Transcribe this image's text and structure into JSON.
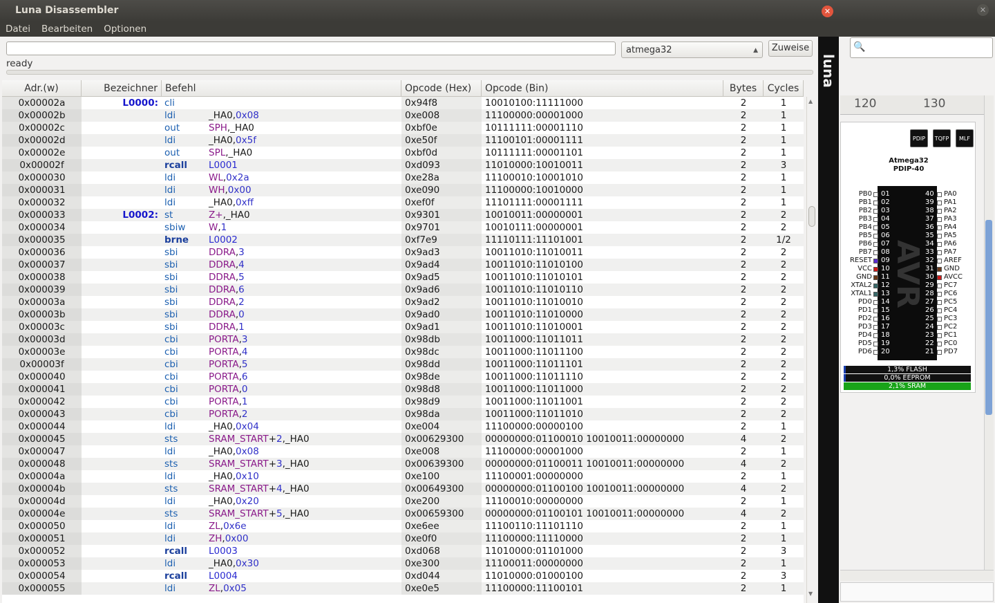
{
  "window": {
    "title": "Luna Disassembler"
  },
  "menu": [
    "Datei",
    "Bearbeiten",
    "Optionen"
  ],
  "toolbar": {
    "path_value": "",
    "chip_selected": "atmega32",
    "assign_label": "Zuweise"
  },
  "status_text": "ready",
  "columns": [
    "Adr.(w)",
    "Bezeichner",
    "Befehl",
    "Opcode (Hex)",
    "Opcode (Bin)",
    "Bytes",
    "Cycles"
  ],
  "rows": [
    {
      "adr": "0x00002a",
      "lbl": "L0000:",
      "mn": "cli",
      "op": [],
      "hex": "0x94f8",
      "bin": "10010100:11111000",
      "bytes": "2",
      "cycles": "1"
    },
    {
      "adr": "0x00002b",
      "lbl": "",
      "mn": "ldi",
      "op": [
        [
          "_HA0",
          "p"
        ],
        [
          ",",
          "p"
        ],
        [
          "0x08",
          "n"
        ]
      ],
      "hex": "0xe008",
      "bin": "11100000:00001000",
      "bytes": "2",
      "cycles": "1"
    },
    {
      "adr": "0x00002c",
      "lbl": "",
      "mn": "out",
      "op": [
        [
          "SPH",
          "r"
        ],
        [
          ",",
          "p"
        ],
        [
          "_HA0",
          "p"
        ]
      ],
      "hex": "0xbf0e",
      "bin": "10111111:00001110",
      "bytes": "2",
      "cycles": "1"
    },
    {
      "adr": "0x00002d",
      "lbl": "",
      "mn": "ldi",
      "op": [
        [
          "_HA0",
          "p"
        ],
        [
          ",",
          "p"
        ],
        [
          "0x5f",
          "n"
        ]
      ],
      "hex": "0xe50f",
      "bin": "11100101:00001111",
      "bytes": "2",
      "cycles": "1"
    },
    {
      "adr": "0x00002e",
      "lbl": "",
      "mn": "out",
      "op": [
        [
          "SPL",
          "r"
        ],
        [
          ",",
          "p"
        ],
        [
          "_HA0",
          "p"
        ]
      ],
      "hex": "0xbf0d",
      "bin": "10111111:00001101",
      "bytes": "2",
      "cycles": "1"
    },
    {
      "adr": "0x00002f",
      "lbl": "",
      "mn": "rcall",
      "bold": true,
      "op": [
        [
          "L0001",
          "l"
        ]
      ],
      "hex": "0xd093",
      "bin": "11010000:10010011",
      "bytes": "2",
      "cycles": "3"
    },
    {
      "adr": "0x000030",
      "lbl": "",
      "mn": "ldi",
      "op": [
        [
          "WL",
          "r"
        ],
        [
          ",",
          "p"
        ],
        [
          "0x2a",
          "n"
        ]
      ],
      "hex": "0xe28a",
      "bin": "11100010:10001010",
      "bytes": "2",
      "cycles": "1"
    },
    {
      "adr": "0x000031",
      "lbl": "",
      "mn": "ldi",
      "op": [
        [
          "WH",
          "r"
        ],
        [
          ",",
          "p"
        ],
        [
          "0x00",
          "n"
        ]
      ],
      "hex": "0xe090",
      "bin": "11100000:10010000",
      "bytes": "2",
      "cycles": "1"
    },
    {
      "adr": "0x000032",
      "lbl": "",
      "mn": "ldi",
      "op": [
        [
          "_HA0",
          "p"
        ],
        [
          ",",
          "p"
        ],
        [
          "0xff",
          "n"
        ]
      ],
      "hex": "0xef0f",
      "bin": "11101111:00001111",
      "bytes": "2",
      "cycles": "1"
    },
    {
      "adr": "0x000033",
      "lbl": "L0002:",
      "mn": "st",
      "op": [
        [
          "Z+",
          "r"
        ],
        [
          ",",
          "p"
        ],
        [
          "_HA0",
          "p"
        ]
      ],
      "hex": "0x9301",
      "bin": "10010011:00000001",
      "bytes": "2",
      "cycles": "2"
    },
    {
      "adr": "0x000034",
      "lbl": "",
      "mn": "sbiw",
      "op": [
        [
          "W",
          "r"
        ],
        [
          ",",
          "p"
        ],
        [
          "1",
          "n"
        ]
      ],
      "hex": "0x9701",
      "bin": "10010111:00000001",
      "bytes": "2",
      "cycles": "2"
    },
    {
      "adr": "0x000035",
      "lbl": "",
      "mn": "brne",
      "bold": true,
      "op": [
        [
          "L0002",
          "l"
        ]
      ],
      "hex": "0xf7e9",
      "bin": "11110111:11101001",
      "bytes": "2",
      "cycles": "1/2"
    },
    {
      "adr": "0x000036",
      "lbl": "",
      "mn": "sbi",
      "op": [
        [
          "DDRA",
          "r"
        ],
        [
          ",",
          "p"
        ],
        [
          "3",
          "n"
        ]
      ],
      "hex": "0x9ad3",
      "bin": "10011010:11010011",
      "bytes": "2",
      "cycles": "2"
    },
    {
      "adr": "0x000037",
      "lbl": "",
      "mn": "sbi",
      "op": [
        [
          "DDRA",
          "r"
        ],
        [
          ",",
          "p"
        ],
        [
          "4",
          "n"
        ]
      ],
      "hex": "0x9ad4",
      "bin": "10011010:11010100",
      "bytes": "2",
      "cycles": "2"
    },
    {
      "adr": "0x000038",
      "lbl": "",
      "mn": "sbi",
      "op": [
        [
          "DDRA",
          "r"
        ],
        [
          ",",
          "p"
        ],
        [
          "5",
          "n"
        ]
      ],
      "hex": "0x9ad5",
      "bin": "10011010:11010101",
      "bytes": "2",
      "cycles": "2"
    },
    {
      "adr": "0x000039",
      "lbl": "",
      "mn": "sbi",
      "op": [
        [
          "DDRA",
          "r"
        ],
        [
          ",",
          "p"
        ],
        [
          "6",
          "n"
        ]
      ],
      "hex": "0x9ad6",
      "bin": "10011010:11010110",
      "bytes": "2",
      "cycles": "2"
    },
    {
      "adr": "0x00003a",
      "lbl": "",
      "mn": "sbi",
      "op": [
        [
          "DDRA",
          "r"
        ],
        [
          ",",
          "p"
        ],
        [
          "2",
          "n"
        ]
      ],
      "hex": "0x9ad2",
      "bin": "10011010:11010010",
      "bytes": "2",
      "cycles": "2"
    },
    {
      "adr": "0x00003b",
      "lbl": "",
      "mn": "sbi",
      "op": [
        [
          "DDRA",
          "r"
        ],
        [
          ",",
          "p"
        ],
        [
          "0",
          "n"
        ]
      ],
      "hex": "0x9ad0",
      "bin": "10011010:11010000",
      "bytes": "2",
      "cycles": "2"
    },
    {
      "adr": "0x00003c",
      "lbl": "",
      "mn": "sbi",
      "op": [
        [
          "DDRA",
          "r"
        ],
        [
          ",",
          "p"
        ],
        [
          "1",
          "n"
        ]
      ],
      "hex": "0x9ad1",
      "bin": "10011010:11010001",
      "bytes": "2",
      "cycles": "2"
    },
    {
      "adr": "0x00003d",
      "lbl": "",
      "mn": "cbi",
      "op": [
        [
          "PORTA",
          "r"
        ],
        [
          ",",
          "p"
        ],
        [
          "3",
          "n"
        ]
      ],
      "hex": "0x98db",
      "bin": "10011000:11011011",
      "bytes": "2",
      "cycles": "2"
    },
    {
      "adr": "0x00003e",
      "lbl": "",
      "mn": "cbi",
      "op": [
        [
          "PORTA",
          "r"
        ],
        [
          ",",
          "p"
        ],
        [
          "4",
          "n"
        ]
      ],
      "hex": "0x98dc",
      "bin": "10011000:11011100",
      "bytes": "2",
      "cycles": "2"
    },
    {
      "adr": "0x00003f",
      "lbl": "",
      "mn": "cbi",
      "op": [
        [
          "PORTA",
          "r"
        ],
        [
          ",",
          "p"
        ],
        [
          "5",
          "n"
        ]
      ],
      "hex": "0x98dd",
      "bin": "10011000:11011101",
      "bytes": "2",
      "cycles": "2"
    },
    {
      "adr": "0x000040",
      "lbl": "",
      "mn": "cbi",
      "op": [
        [
          "PORTA",
          "r"
        ],
        [
          ",",
          "p"
        ],
        [
          "6",
          "n"
        ]
      ],
      "hex": "0x98de",
      "bin": "10011000:11011110",
      "bytes": "2",
      "cycles": "2"
    },
    {
      "adr": "0x000041",
      "lbl": "",
      "mn": "cbi",
      "op": [
        [
          "PORTA",
          "r"
        ],
        [
          ",",
          "p"
        ],
        [
          "0",
          "n"
        ]
      ],
      "hex": "0x98d8",
      "bin": "10011000:11011000",
      "bytes": "2",
      "cycles": "2"
    },
    {
      "adr": "0x000042",
      "lbl": "",
      "mn": "cbi",
      "op": [
        [
          "PORTA",
          "r"
        ],
        [
          ",",
          "p"
        ],
        [
          "1",
          "n"
        ]
      ],
      "hex": "0x98d9",
      "bin": "10011000:11011001",
      "bytes": "2",
      "cycles": "2"
    },
    {
      "adr": "0x000043",
      "lbl": "",
      "mn": "cbi",
      "op": [
        [
          "PORTA",
          "r"
        ],
        [
          ",",
          "p"
        ],
        [
          "2",
          "n"
        ]
      ],
      "hex": "0x98da",
      "bin": "10011000:11011010",
      "bytes": "2",
      "cycles": "2"
    },
    {
      "adr": "0x000044",
      "lbl": "",
      "mn": "ldi",
      "op": [
        [
          "_HA0",
          "p"
        ],
        [
          ",",
          "p"
        ],
        [
          "0x04",
          "n"
        ]
      ],
      "hex": "0xe004",
      "bin": "11100000:00000100",
      "bytes": "2",
      "cycles": "1"
    },
    {
      "adr": "0x000045",
      "lbl": "",
      "mn": "sts",
      "op": [
        [
          "SRAM_START",
          "r"
        ],
        [
          "+",
          "p"
        ],
        [
          "2",
          "n"
        ],
        [
          ",",
          "p"
        ],
        [
          "_HA0",
          "p"
        ]
      ],
      "hex": "0x00629300",
      "bin": "00000000:01100010 10010011:00000000",
      "bytes": "4",
      "cycles": "2"
    },
    {
      "adr": "0x000047",
      "lbl": "",
      "mn": "ldi",
      "op": [
        [
          "_HA0",
          "p"
        ],
        [
          ",",
          "p"
        ],
        [
          "0x08",
          "n"
        ]
      ],
      "hex": "0xe008",
      "bin": "11100000:00001000",
      "bytes": "2",
      "cycles": "1"
    },
    {
      "adr": "0x000048",
      "lbl": "",
      "mn": "sts",
      "op": [
        [
          "SRAM_START",
          "r"
        ],
        [
          "+",
          "p"
        ],
        [
          "3",
          "n"
        ],
        [
          ",",
          "p"
        ],
        [
          "_HA0",
          "p"
        ]
      ],
      "hex": "0x00639300",
      "bin": "00000000:01100011 10010011:00000000",
      "bytes": "4",
      "cycles": "2"
    },
    {
      "adr": "0x00004a",
      "lbl": "",
      "mn": "ldi",
      "op": [
        [
          "_HA0",
          "p"
        ],
        [
          ",",
          "p"
        ],
        [
          "0x10",
          "n"
        ]
      ],
      "hex": "0xe100",
      "bin": "11100001:00000000",
      "bytes": "2",
      "cycles": "1"
    },
    {
      "adr": "0x00004b",
      "lbl": "",
      "mn": "sts",
      "op": [
        [
          "SRAM_START",
          "r"
        ],
        [
          "+",
          "p"
        ],
        [
          "4",
          "n"
        ],
        [
          ",",
          "p"
        ],
        [
          "_HA0",
          "p"
        ]
      ],
      "hex": "0x00649300",
      "bin": "00000000:01100100 10010011:00000000",
      "bytes": "4",
      "cycles": "2"
    },
    {
      "adr": "0x00004d",
      "lbl": "",
      "mn": "ldi",
      "op": [
        [
          "_HA0",
          "p"
        ],
        [
          ",",
          "p"
        ],
        [
          "0x20",
          "n"
        ]
      ],
      "hex": "0xe200",
      "bin": "11100010:00000000",
      "bytes": "2",
      "cycles": "1"
    },
    {
      "adr": "0x00004e",
      "lbl": "",
      "mn": "sts",
      "op": [
        [
          "SRAM_START",
          "r"
        ],
        [
          "+",
          "p"
        ],
        [
          "5",
          "n"
        ],
        [
          ",",
          "p"
        ],
        [
          "_HA0",
          "p"
        ]
      ],
      "hex": "0x00659300",
      "bin": "00000000:01100101 10010011:00000000",
      "bytes": "4",
      "cycles": "2"
    },
    {
      "adr": "0x000050",
      "lbl": "",
      "mn": "ldi",
      "op": [
        [
          "ZL",
          "r"
        ],
        [
          ",",
          "p"
        ],
        [
          "0x6e",
          "n"
        ]
      ],
      "hex": "0xe6ee",
      "bin": "11100110:11101110",
      "bytes": "2",
      "cycles": "1"
    },
    {
      "adr": "0x000051",
      "lbl": "",
      "mn": "ldi",
      "op": [
        [
          "ZH",
          "r"
        ],
        [
          ",",
          "p"
        ],
        [
          "0x00",
          "n"
        ]
      ],
      "hex": "0xe0f0",
      "bin": "11100000:11110000",
      "bytes": "2",
      "cycles": "1"
    },
    {
      "adr": "0x000052",
      "lbl": "",
      "mn": "rcall",
      "bold": true,
      "op": [
        [
          "L0003",
          "l"
        ]
      ],
      "hex": "0xd068",
      "bin": "11010000:01101000",
      "bytes": "2",
      "cycles": "3"
    },
    {
      "adr": "0x000053",
      "lbl": "",
      "mn": "ldi",
      "op": [
        [
          "_HA0",
          "p"
        ],
        [
          ",",
          "p"
        ],
        [
          "0x30",
          "n"
        ]
      ],
      "hex": "0xe300",
      "bin": "11100011:00000000",
      "bytes": "2",
      "cycles": "1"
    },
    {
      "adr": "0x000054",
      "lbl": "",
      "mn": "rcall",
      "bold": true,
      "op": [
        [
          "L0004",
          "l"
        ]
      ],
      "hex": "0xd044",
      "bin": "11010000:01000100",
      "bytes": "2",
      "cycles": "3"
    },
    {
      "adr": "0x000055",
      "lbl": "",
      "mn": "ldi",
      "op": [
        [
          "ZL",
          "r"
        ],
        [
          ",",
          "p"
        ],
        [
          "0x05",
          "n"
        ]
      ],
      "hex": "0xe0e5",
      "bin": "11100000:11100101",
      "bytes": "2",
      "cycles": "1"
    }
  ],
  "side_logo_text": "luna",
  "right_panel": {
    "ruler_ticks": [
      "120",
      "130"
    ],
    "package_buttons": [
      "PDIP",
      "TQFP",
      "MLF"
    ],
    "chip_name": "Atmega32",
    "chip_package": "PDIP-40",
    "chip_logo": "AVR",
    "left_pins": [
      {
        "name": "PB0",
        "num": "01",
        "color": "#ffffff"
      },
      {
        "name": "PB1",
        "num": "02",
        "color": "#ffffff"
      },
      {
        "name": "PB2",
        "num": "03",
        "color": "#ffffff"
      },
      {
        "name": "PB3",
        "num": "04",
        "color": "#ffffff"
      },
      {
        "name": "PB4",
        "num": "05",
        "color": "#ffffff"
      },
      {
        "name": "PB5",
        "num": "06",
        "color": "#ffffff"
      },
      {
        "name": "PB6",
        "num": "07",
        "color": "#ffffff"
      },
      {
        "name": "PB7",
        "num": "08",
        "color": "#ffffff"
      },
      {
        "name": "RESET",
        "num": "09",
        "color": "#5a2bd0"
      },
      {
        "name": "VCC",
        "num": "10",
        "color": "#d01a1a"
      },
      {
        "name": "GND",
        "num": "11",
        "color": "#6b3a1a"
      },
      {
        "name": "XTAL2",
        "num": "12",
        "color": "#3a6b6b"
      },
      {
        "name": "XTAL1",
        "num": "13",
        "color": "#3a6b6b"
      },
      {
        "name": "PD0",
        "num": "14",
        "color": "#ffffff"
      },
      {
        "name": "PD1",
        "num": "15",
        "color": "#ffffff"
      },
      {
        "name": "PD2",
        "num": "16",
        "color": "#ffffff"
      },
      {
        "name": "PD3",
        "num": "17",
        "color": "#ffffff"
      },
      {
        "name": "PD4",
        "num": "18",
        "color": "#ffffff"
      },
      {
        "name": "PD5",
        "num": "19",
        "color": "#ffffff"
      },
      {
        "name": "PD6",
        "num": "20",
        "color": "#ffffff"
      }
    ],
    "right_pins": [
      {
        "name": "PA0",
        "num": "40",
        "color": "#ffffff"
      },
      {
        "name": "PA1",
        "num": "39",
        "color": "#ffffff"
      },
      {
        "name": "PA2",
        "num": "38",
        "color": "#ffffff"
      },
      {
        "name": "PA3",
        "num": "37",
        "color": "#ffffff"
      },
      {
        "name": "PA4",
        "num": "36",
        "color": "#ffffff"
      },
      {
        "name": "PA5",
        "num": "35",
        "color": "#ffffff"
      },
      {
        "name": "PA6",
        "num": "34",
        "color": "#ffffff"
      },
      {
        "name": "PA7",
        "num": "33",
        "color": "#ffffff"
      },
      {
        "name": "AREF",
        "num": "32",
        "color": "#ffffff"
      },
      {
        "name": "GND",
        "num": "31",
        "color": "#6b3a1a"
      },
      {
        "name": "AVCC",
        "num": "30",
        "color": "#d01a1a"
      },
      {
        "name": "PC7",
        "num": "29",
        "color": "#ffffff"
      },
      {
        "name": "PC6",
        "num": "28",
        "color": "#ffffff"
      },
      {
        "name": "PC5",
        "num": "27",
        "color": "#ffffff"
      },
      {
        "name": "PC4",
        "num": "26",
        "color": "#ffffff"
      },
      {
        "name": "PC3",
        "num": "25",
        "color": "#ffffff"
      },
      {
        "name": "PC2",
        "num": "24",
        "color": "#ffffff"
      },
      {
        "name": "PC1",
        "num": "23",
        "color": "#ffffff"
      },
      {
        "name": "PC0",
        "num": "22",
        "color": "#ffffff"
      },
      {
        "name": "PD7",
        "num": "21",
        "color": "#ffffff"
      }
    ],
    "memory": [
      {
        "label": "1,3% FLASH",
        "fraction": 0.013,
        "color": "#1a3fb0"
      },
      {
        "label": "0,0% EEPROM",
        "fraction": 0.0,
        "color": "#1a3fb0"
      },
      {
        "label": "2,1% SRAM",
        "fraction": 1.0,
        "color": "#19a319"
      }
    ]
  },
  "colors": {
    "label": "#1515cc",
    "register": "#8a1a8a",
    "number": "#3030c8",
    "mnemonic": "#1b5fb0"
  }
}
